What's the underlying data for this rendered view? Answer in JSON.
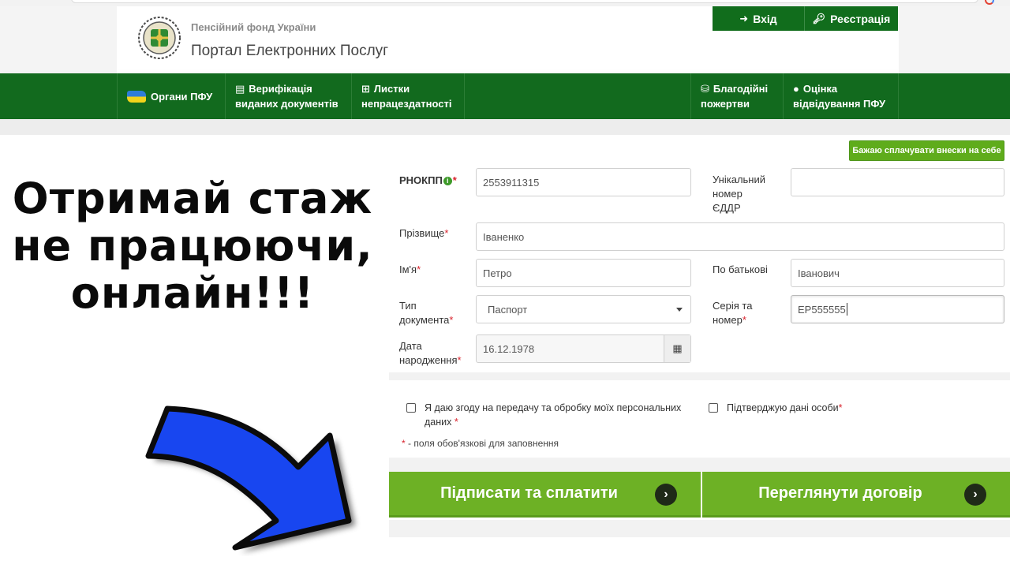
{
  "header": {
    "org_name": "Пенсійний фонд України",
    "portal_name": "Портал Електронних Послуг",
    "login_label": "Вхід",
    "register_label": "Реєстрація"
  },
  "nav": {
    "organy": "Органи ПФУ",
    "verif_line1": "Верифікація",
    "verif_line2": "виданих документів",
    "lystky_line1": "Листки",
    "lystky_line2": "непрацездатності",
    "blag_line1": "Благодійні",
    "blag_line2": "пожертви",
    "otsinka_line1": "Оцінка",
    "otsinka_line2": "відвідування ПФУ"
  },
  "caption": {
    "line1": "Отримай стаж",
    "line2": "не працюючи,",
    "line3": "онлайн!!!"
  },
  "form": {
    "self_pay_button": "Бажаю сплачувати внески на себе",
    "rnokpp_label": "РНОКПП",
    "rnokpp_value": "2553911315",
    "unique_label_1": "Унікальний",
    "unique_label_2": "номер",
    "unique_label_3": "ЄДДР",
    "unique_value": "",
    "surname_label": "Прізвище",
    "surname_value": "Іваненко",
    "name_label": "Ім'я",
    "name_value": "Петро",
    "patronymic_label": "По батькові",
    "patronymic_value": "Іванович",
    "doctype_label_1": "Тип",
    "doctype_label_2": "документа",
    "doctype_value": "Паспорт",
    "series_label_1": "Серія та",
    "series_label_2": "номер",
    "series_value": "ЕР555555",
    "birth_label_1": "Дата",
    "birth_label_2": "народження",
    "birth_value": "16.12.1978",
    "required_mark": "*",
    "consent_line1": "Я даю згоду на передачу та обробку моїх персональних",
    "consent_line2": "даних",
    "confirm_label": "Підтверджую дані особи",
    "hint_text": "- поля обов'язкові для заповнення",
    "sign_button": "Підписати та сплатити",
    "view_button": "Переглянути договір"
  },
  "icons": {
    "login": "sign-in-icon",
    "register": "key-icon",
    "verif": "document-icon",
    "lystky": "medkit-icon",
    "blag": "coins-icon",
    "otsinka": "comment-icon",
    "calendar": "calendar-icon",
    "chevron": "chevron-right-icon"
  },
  "colors": {
    "nav_green": "#126a1e",
    "button_green": "#6db125",
    "arrow_blue": "#1846f0"
  }
}
